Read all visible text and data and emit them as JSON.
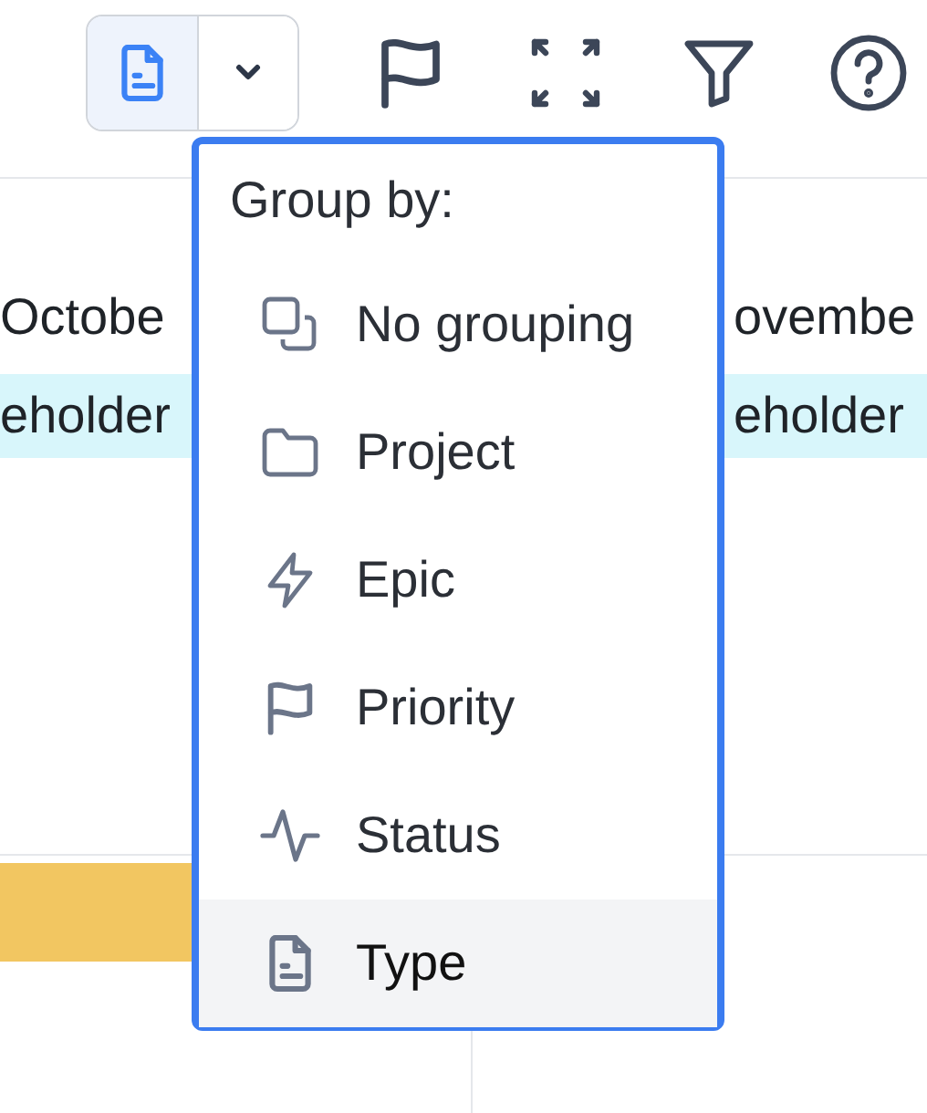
{
  "toolbar": {
    "group_button": {
      "selected": true
    }
  },
  "timeline": {
    "columns": [
      {
        "label": "Octobe"
      },
      {
        "label": "ovembe"
      }
    ],
    "row": {
      "cells": [
        "eholder",
        "eholder"
      ]
    }
  },
  "group_menu": {
    "title": "Group by:",
    "items": [
      {
        "label": "No grouping",
        "selected": false
      },
      {
        "label": "Project",
        "selected": false
      },
      {
        "label": "Epic",
        "selected": false
      },
      {
        "label": "Priority",
        "selected": false
      },
      {
        "label": "Status",
        "selected": false
      },
      {
        "label": "Type",
        "selected": true
      }
    ]
  }
}
